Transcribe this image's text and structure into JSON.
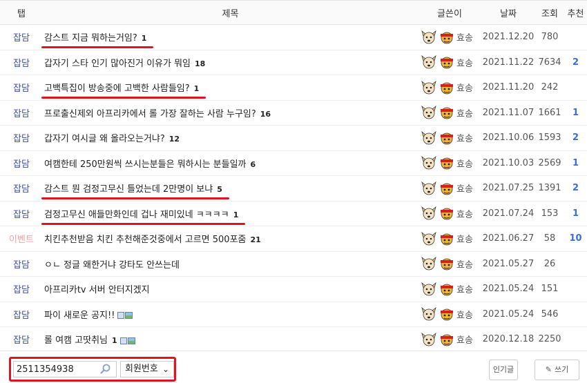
{
  "header": {
    "tab": "탭",
    "title": "제목",
    "writer": "글쓴이",
    "date": "날짜",
    "views": "조회",
    "recommend": "추천"
  },
  "rows": [
    {
      "tab": "잡담",
      "event": false,
      "title": "감스트 지금 뭐하는거임?",
      "count": "1",
      "files": false,
      "writer": "효송",
      "date": "2021.12.20",
      "views": "780",
      "rec": "",
      "highlight": true
    },
    {
      "tab": "잡담",
      "event": false,
      "title": "갑자기 스타 인기 많아진거 이유가 뭐임",
      "count": "18",
      "files": false,
      "writer": "효송",
      "date": "2021.11.22",
      "views": "7634",
      "rec": "2",
      "highlight": false
    },
    {
      "tab": "잡담",
      "event": false,
      "title": "고백특집이 방송중에 고백한 사람들임?",
      "count": "1",
      "files": false,
      "writer": "효송",
      "date": "2021.11.20",
      "views": "242",
      "rec": "",
      "highlight": true
    },
    {
      "tab": "잡담",
      "event": false,
      "title": "프로출신제외 아프리카에서 롤 가장 잘하는 사람 누구임?",
      "count": "16",
      "files": false,
      "writer": "효송",
      "date": "2021.11.07",
      "views": "1661",
      "rec": "1",
      "highlight": false
    },
    {
      "tab": "잡담",
      "event": false,
      "title": "갑자기 여시글 왜 올라오는거냐?",
      "count": "12",
      "files": false,
      "writer": "효송",
      "date": "2021.10.06",
      "views": "1593",
      "rec": "2",
      "highlight": false
    },
    {
      "tab": "잡담",
      "event": false,
      "title": "여캠한테 250만원씩 쓰시는분들은 뭐하시는 분들일까",
      "count": "6",
      "files": false,
      "writer": "효송",
      "date": "2021.10.03",
      "views": "2569",
      "rec": "1",
      "highlight": false
    },
    {
      "tab": "잡담",
      "event": false,
      "title": "감스트 뭔 검정고무신 틀었는데 2만명이 보냐",
      "count": "5",
      "files": false,
      "writer": "효송",
      "date": "2021.07.25",
      "views": "1391",
      "rec": "2",
      "highlight": true
    },
    {
      "tab": "잡담",
      "event": false,
      "title": "검정고무신 애들만화인데 겁나 재미있네 ㅋㅋㅋㅋ",
      "count": "1",
      "files": false,
      "writer": "효송",
      "date": "2021.07.24",
      "views": "153",
      "rec": "1",
      "highlight": true
    },
    {
      "tab": "이벤트",
      "event": true,
      "title": "치킨추천받음 치킨 추천해준것중에서 고르면 500포줌",
      "count": "21",
      "files": false,
      "writer": "효송",
      "date": "2021.06.27",
      "views": "58",
      "rec": "10",
      "highlight": false
    },
    {
      "tab": "잡담",
      "event": false,
      "title": "ㅇㄴ 정글 왜한거냐 강타도 안쓰는데",
      "count": "",
      "files": false,
      "writer": "효송",
      "date": "2021.05.27",
      "views": "26",
      "rec": "",
      "highlight": false
    },
    {
      "tab": "잡담",
      "event": false,
      "title": "아프리카tv 서버 안터지겠지",
      "count": "",
      "files": false,
      "writer": "효송",
      "date": "2021.05.24",
      "views": "151",
      "rec": "",
      "highlight": false
    },
    {
      "tab": "잡담",
      "event": false,
      "title": "파이 새로운 공지!!",
      "count": "",
      "files": true,
      "writer": "효송",
      "date": "2021.05.24",
      "views": "546",
      "rec": "",
      "highlight": false
    },
    {
      "tab": "잡담",
      "event": false,
      "title": "롤 여캠 고땃취님",
      "count": "1",
      "files": true,
      "writer": "효송",
      "date": "2020.12.18",
      "views": "2250",
      "rec": "",
      "highlight": false
    }
  ],
  "search": {
    "value": "2511354938",
    "select_value": "회원번호",
    "icon": "search-icon"
  },
  "buttons": {
    "popular": "인기글",
    "write": "쓰기"
  },
  "colors": {
    "accent": "#e0141e",
    "tab": "#3a4da0",
    "event": "#f0a0a0",
    "recommend": "#3a6fd8"
  }
}
